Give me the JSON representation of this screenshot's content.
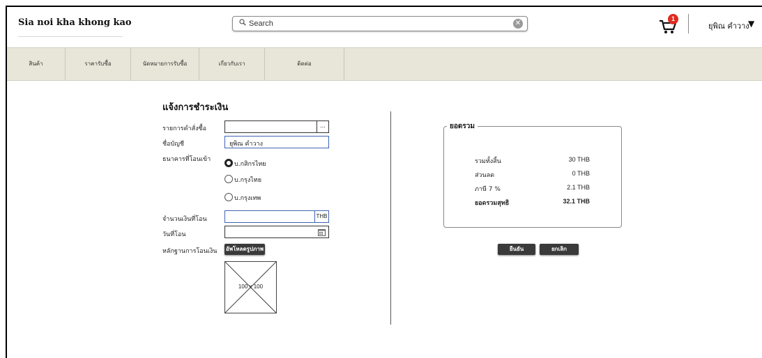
{
  "header": {
    "app_title": "Sia noi kha khong kao",
    "search_placeholder": "Search",
    "cart_count": "1",
    "user_name": "ยุพิณ คำวาง",
    "user_caret": "▼"
  },
  "nav": {
    "items": [
      "สินค้า",
      "ราคารับซื้อ",
      "นัดหมายการรับซื้อ",
      "เกี่ยวกับเรา",
      "ติดต่อ"
    ]
  },
  "form": {
    "title": "แจ้งการชำระเงิน",
    "order_label": "รายการคำสั่งซื้อ",
    "order_value": "",
    "order_browse": "...",
    "account_label": "ชื่อบัญชี",
    "account_value": "ยุพิณ คำวาง",
    "bank_label": "ธนาคารที่โอนเข้า",
    "banks": [
      "บ.กสิกรไทย",
      "บ.กรุงไทย",
      "บ.กรุงเทพ"
    ],
    "selected_bank_index": 0,
    "amount_label": "จำนวนเงินที่โอน",
    "amount_value": "",
    "amount_unit": "THB",
    "date_label": "วันที่โอน",
    "date_value": "",
    "proof_label": "หลักฐานการโอนเงิน",
    "upload_button": "อัพโหลดรูปภาพ",
    "image_placeholder": "100 x 100"
  },
  "summary": {
    "legend": "ยอดรวม",
    "rows": [
      {
        "label": "รวมทั้งสิ้น",
        "value": "30 THB"
      },
      {
        "label": "ส่วนลด",
        "value": "0 THB"
      },
      {
        "label": "ภาษี 7 %",
        "value": "2.1 THB"
      },
      {
        "label": "ยอดรวมสุทธิ",
        "value": "32.1 THB"
      }
    ],
    "confirm_button": "ยืนยัน",
    "cancel_button": "ยกเลิก"
  },
  "colors": {
    "nav_bg": "#e8e6d8",
    "badge": "#e02b1f",
    "button_dark": "#3a3a3a",
    "field_border_active": "#3f63b6"
  }
}
